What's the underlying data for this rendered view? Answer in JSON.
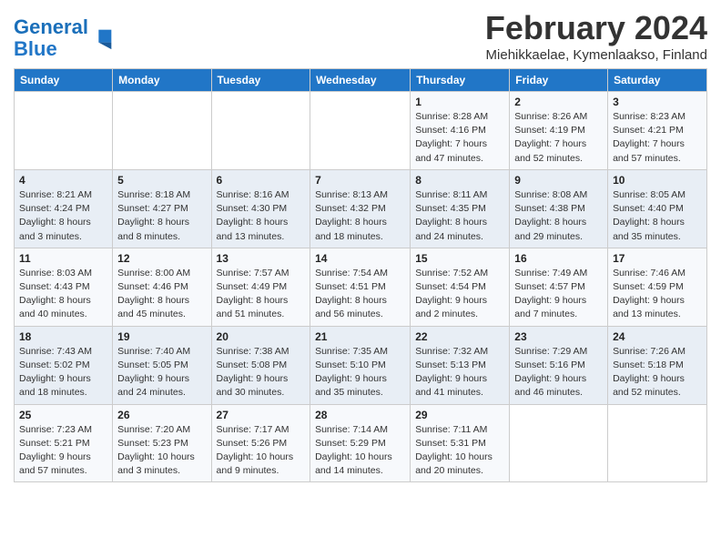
{
  "header": {
    "logo_line1": "General",
    "logo_line2": "Blue",
    "month_year": "February 2024",
    "location": "Miehikkaelae, Kymenlaakso, Finland"
  },
  "weekdays": [
    "Sunday",
    "Monday",
    "Tuesday",
    "Wednesday",
    "Thursday",
    "Friday",
    "Saturday"
  ],
  "weeks": [
    [
      {
        "day": "",
        "info": ""
      },
      {
        "day": "",
        "info": ""
      },
      {
        "day": "",
        "info": ""
      },
      {
        "day": "",
        "info": ""
      },
      {
        "day": "1",
        "info": "Sunrise: 8:28 AM\nSunset: 4:16 PM\nDaylight: 7 hours\nand 47 minutes."
      },
      {
        "day": "2",
        "info": "Sunrise: 8:26 AM\nSunset: 4:19 PM\nDaylight: 7 hours\nand 52 minutes."
      },
      {
        "day": "3",
        "info": "Sunrise: 8:23 AM\nSunset: 4:21 PM\nDaylight: 7 hours\nand 57 minutes."
      }
    ],
    [
      {
        "day": "4",
        "info": "Sunrise: 8:21 AM\nSunset: 4:24 PM\nDaylight: 8 hours\nand 3 minutes."
      },
      {
        "day": "5",
        "info": "Sunrise: 8:18 AM\nSunset: 4:27 PM\nDaylight: 8 hours\nand 8 minutes."
      },
      {
        "day": "6",
        "info": "Sunrise: 8:16 AM\nSunset: 4:30 PM\nDaylight: 8 hours\nand 13 minutes."
      },
      {
        "day": "7",
        "info": "Sunrise: 8:13 AM\nSunset: 4:32 PM\nDaylight: 8 hours\nand 18 minutes."
      },
      {
        "day": "8",
        "info": "Sunrise: 8:11 AM\nSunset: 4:35 PM\nDaylight: 8 hours\nand 24 minutes."
      },
      {
        "day": "9",
        "info": "Sunrise: 8:08 AM\nSunset: 4:38 PM\nDaylight: 8 hours\nand 29 minutes."
      },
      {
        "day": "10",
        "info": "Sunrise: 8:05 AM\nSunset: 4:40 PM\nDaylight: 8 hours\nand 35 minutes."
      }
    ],
    [
      {
        "day": "11",
        "info": "Sunrise: 8:03 AM\nSunset: 4:43 PM\nDaylight: 8 hours\nand 40 minutes."
      },
      {
        "day": "12",
        "info": "Sunrise: 8:00 AM\nSunset: 4:46 PM\nDaylight: 8 hours\nand 45 minutes."
      },
      {
        "day": "13",
        "info": "Sunrise: 7:57 AM\nSunset: 4:49 PM\nDaylight: 8 hours\nand 51 minutes."
      },
      {
        "day": "14",
        "info": "Sunrise: 7:54 AM\nSunset: 4:51 PM\nDaylight: 8 hours\nand 56 minutes."
      },
      {
        "day": "15",
        "info": "Sunrise: 7:52 AM\nSunset: 4:54 PM\nDaylight: 9 hours\nand 2 minutes."
      },
      {
        "day": "16",
        "info": "Sunrise: 7:49 AM\nSunset: 4:57 PM\nDaylight: 9 hours\nand 7 minutes."
      },
      {
        "day": "17",
        "info": "Sunrise: 7:46 AM\nSunset: 4:59 PM\nDaylight: 9 hours\nand 13 minutes."
      }
    ],
    [
      {
        "day": "18",
        "info": "Sunrise: 7:43 AM\nSunset: 5:02 PM\nDaylight: 9 hours\nand 18 minutes."
      },
      {
        "day": "19",
        "info": "Sunrise: 7:40 AM\nSunset: 5:05 PM\nDaylight: 9 hours\nand 24 minutes."
      },
      {
        "day": "20",
        "info": "Sunrise: 7:38 AM\nSunset: 5:08 PM\nDaylight: 9 hours\nand 30 minutes."
      },
      {
        "day": "21",
        "info": "Sunrise: 7:35 AM\nSunset: 5:10 PM\nDaylight: 9 hours\nand 35 minutes."
      },
      {
        "day": "22",
        "info": "Sunrise: 7:32 AM\nSunset: 5:13 PM\nDaylight: 9 hours\nand 41 minutes."
      },
      {
        "day": "23",
        "info": "Sunrise: 7:29 AM\nSunset: 5:16 PM\nDaylight: 9 hours\nand 46 minutes."
      },
      {
        "day": "24",
        "info": "Sunrise: 7:26 AM\nSunset: 5:18 PM\nDaylight: 9 hours\nand 52 minutes."
      }
    ],
    [
      {
        "day": "25",
        "info": "Sunrise: 7:23 AM\nSunset: 5:21 PM\nDaylight: 9 hours\nand 57 minutes."
      },
      {
        "day": "26",
        "info": "Sunrise: 7:20 AM\nSunset: 5:23 PM\nDaylight: 10 hours\nand 3 minutes."
      },
      {
        "day": "27",
        "info": "Sunrise: 7:17 AM\nSunset: 5:26 PM\nDaylight: 10 hours\nand 9 minutes."
      },
      {
        "day": "28",
        "info": "Sunrise: 7:14 AM\nSunset: 5:29 PM\nDaylight: 10 hours\nand 14 minutes."
      },
      {
        "day": "29",
        "info": "Sunrise: 7:11 AM\nSunset: 5:31 PM\nDaylight: 10 hours\nand 20 minutes."
      },
      {
        "day": "",
        "info": ""
      },
      {
        "day": "",
        "info": ""
      }
    ]
  ]
}
